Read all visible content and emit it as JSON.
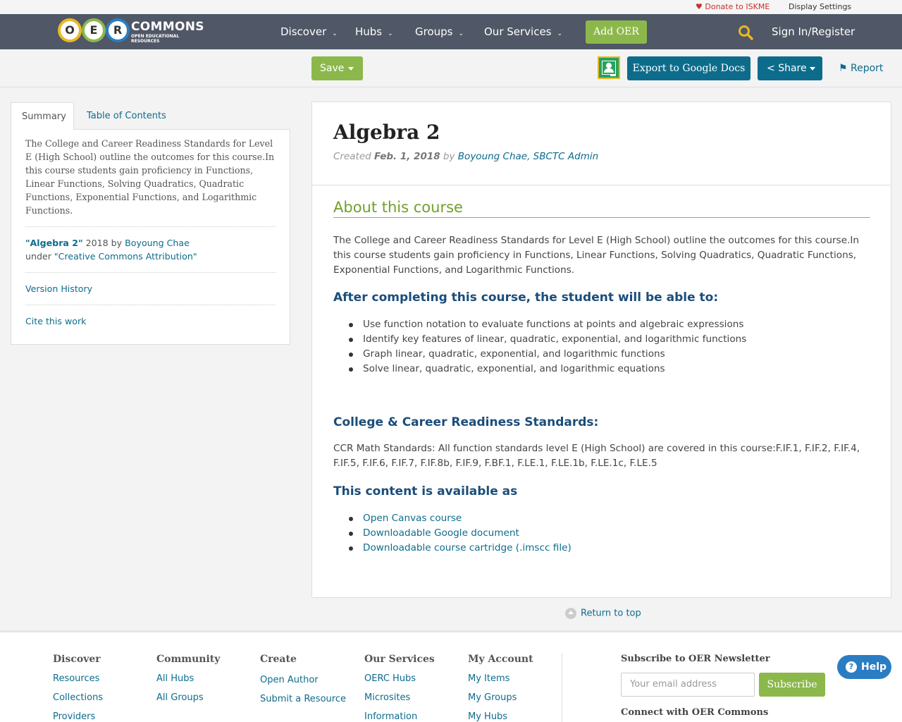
{
  "topbar": {
    "donate": "Donate to ISKME",
    "settings": "Display Settings"
  },
  "logo": {
    "letters": [
      "O",
      "E",
      "R"
    ],
    "word": "COMMONS",
    "sub": "OPEN EDUCATIONAL RESOURCES"
  },
  "nav": {
    "items": [
      "Discover",
      "Hubs",
      "Groups",
      "Our Services"
    ],
    "add_oer": "Add OER",
    "signin": "Sign In/Register"
  },
  "toolbar": {
    "save": "Save",
    "export": "Export to Google Docs",
    "share": "Share",
    "report": "Report"
  },
  "sidebar": {
    "tabs": [
      "Summary",
      "Table of Contents"
    ],
    "description": "The College and Career Readiness Standards for Level E (High School) outline the outcomes for this course.In this course students gain proficiency in Functions, Linear Functions, Solving Quadratics, Quadratic Functions, Exponential Functions, and Logarithmic Functions.",
    "license_title": "\"Algebra 2\"",
    "license_year_by": " 2018 by ",
    "license_author": "Boyoung Chae",
    "license_under": "under ",
    "license_name": "\"Creative Commons Attribution\"",
    "version_history": "Version History",
    "cite": "Cite this work"
  },
  "main": {
    "title": "Algebra 2",
    "created_label": "Created ",
    "created_date": "Feb. 1, 2018",
    "by": " by ",
    "authors": "Boyoung Chae, SBCTC Admin",
    "about_heading": "About this course",
    "about_text": "The College and Career Readiness Standards for Level E (High School) outline the outcomes for this course.In this course students gain proficiency in Functions, Linear Functions, Solving Quadratics, Quadratic Functions, Exponential Functions, and Logarithmic Functions.",
    "outcomes_heading": "After completing this course, the student will be able to:",
    "outcomes": [
      "Use function notation to evaluate functions at points and algebraic expressions",
      "Identify key features of linear, quadratic, exponential, and logarithmic functions",
      "Graph linear, quadratic, exponential, and logarithmic functions",
      "Solve linear, quadratic, exponential, and logarithmic equations"
    ],
    "standards_heading": "College & Career Readiness Standards:",
    "standards_text": "CCR Math Standards: All function standards level E (High School) are covered in this course:F.IF.1, F.IF.2, F.IF.4, F.IF.5, F.IF.6, F.IF.7, F.IF.8b, F.IF.9, F.BF.1, F.LE.1, F.LE.1b, F.LE.1c, F.LE.5",
    "available_heading": "This content is available as",
    "available": [
      "Open Canvas course",
      "Downloadable Google document",
      "Downloadable course cartridge (.imscc file)"
    ]
  },
  "return_top": "Return to top",
  "footer": {
    "columns": [
      {
        "heading": "Discover",
        "links": [
          "Resources",
          "Collections",
          "Providers"
        ]
      },
      {
        "heading": "Community",
        "links": [
          "All Hubs",
          "All Groups"
        ]
      },
      {
        "heading": "Create",
        "links": [
          "Open Author",
          "Submit a Resource"
        ]
      },
      {
        "heading": "Our Services",
        "links": [
          "OERC Hubs",
          "Microsites",
          "Information"
        ]
      },
      {
        "heading": "My Account",
        "links": [
          "My Items",
          "My Groups",
          "My Hubs"
        ]
      }
    ],
    "newsletter_heading": "Subscribe to OER Newsletter",
    "email_placeholder": "Your email address",
    "subscribe": "Subscribe",
    "connect": "Connect with OER Commons"
  },
  "help": "Help",
  "colors": {
    "nav_bg": "#505766",
    "green": "#8cb84b",
    "teal": "#0d6c8c",
    "heading_blue": "#1b4d7a"
  }
}
